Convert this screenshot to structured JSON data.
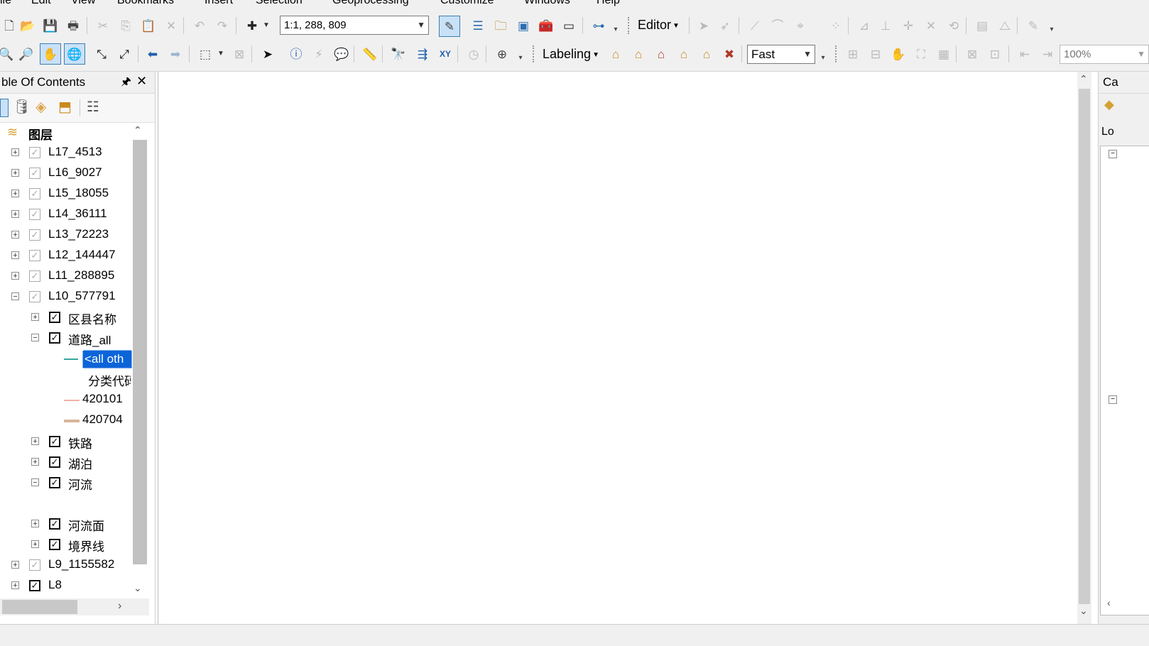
{
  "menu": {
    "items": [
      "ile",
      "Edit",
      "View",
      "Bookmarks",
      "Insert",
      "Selection",
      "Geoprocessing",
      "Customize",
      "Windows",
      "Help"
    ]
  },
  "toolbar": {
    "scale_value": "1:1, 288, 809",
    "editor_label": "Editor",
    "labeling_label": "Labeling",
    "quality_value": "Fast",
    "zoom_value": "100%"
  },
  "toc": {
    "title": "ble Of Contents",
    "root_label": "图层",
    "layers": [
      {
        "label": "L17_4513"
      },
      {
        "label": "L16_9027"
      },
      {
        "label": "L15_18055"
      },
      {
        "label": "L14_36111"
      },
      {
        "label": "L13_72223"
      },
      {
        "label": "L12_144447"
      },
      {
        "label": "L11_288895"
      },
      {
        "label": "L10_577791"
      }
    ],
    "sublayers": {
      "district_names": "区县名称",
      "roads_all": "道路_all",
      "all_other": "<all oth",
      "class_code": "分类代码",
      "code_1": "420101",
      "code_2": "420704",
      "railway": "铁路",
      "lakes": "湖泊",
      "rivers": "河流",
      "river_surface": "河流面",
      "boundary": "境界线"
    },
    "lower_layers": [
      {
        "label": "L9_1155582"
      },
      {
        "label": "L8"
      }
    ]
  },
  "right_panel": {
    "tab_label": "Ca",
    "loc_label": "Lo"
  },
  "colors": {
    "accent_select": "#0b64d8",
    "road_other": "#3aa6a0",
    "road_420101": "#f0b0a6",
    "road_420704": "#d9b59a"
  }
}
